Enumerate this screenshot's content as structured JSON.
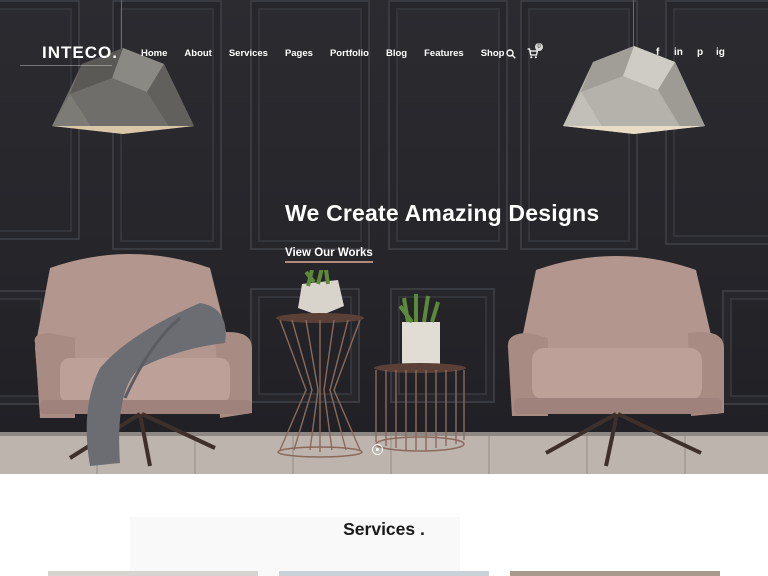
{
  "header": {
    "logo": "INTECO.",
    "nav": [
      "Home",
      "About",
      "Services",
      "Pages",
      "Portfolio",
      "Blog",
      "Features",
      "Shop"
    ],
    "icons": [
      "search-icon",
      "cart-icon"
    ],
    "cart_count": "0",
    "social": [
      "f",
      "in",
      "p",
      "ig"
    ]
  },
  "hero": {
    "title": "We Create Amazing Designs",
    "cta": "View Our Works"
  },
  "services": {
    "title": "Services ."
  },
  "colors": {
    "accent_underline": "#b08a7c",
    "wall": "#25252a",
    "chair": "#b89a92"
  }
}
